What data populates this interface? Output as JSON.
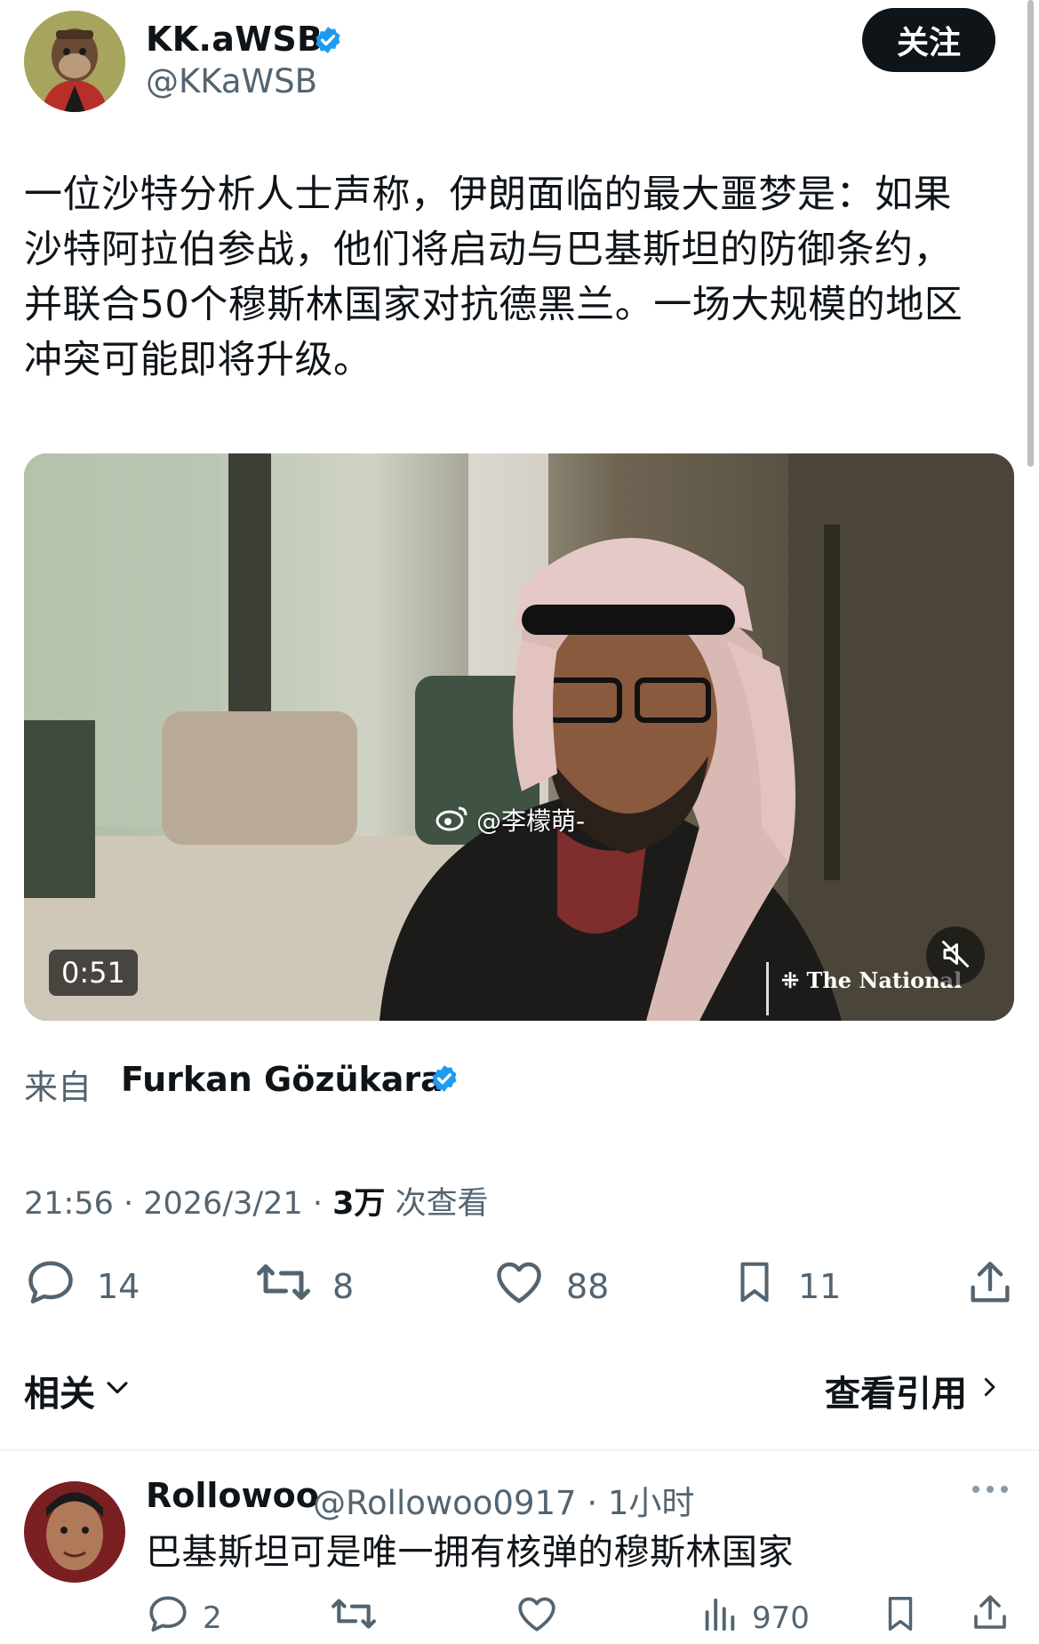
{
  "author": {
    "display_name": "KK.aWSB",
    "handle": "@KKaWSB",
    "verified": true
  },
  "follow_button": "关注",
  "tweet": {
    "text": "一位沙特分析人士声称，伊朗面临的最大噩梦是：如果\n沙特阿拉伯参战，他们将启动与巴基斯坦的防御条约，\n并联合50个穆斯林国家对抗德黑兰。一场大规模的地区\n冲突可能即将升级。"
  },
  "video": {
    "duration": "0:51",
    "brand": "The National",
    "watermark": "@李檬萌-"
  },
  "source": {
    "label": "来自",
    "name": "Furkan Gözükara"
  },
  "meta": {
    "time": "21:56 · 2026/3/21 · ",
    "views_count": "3万",
    "views_label": " 次查看"
  },
  "actions": {
    "replies": "14",
    "retweets": "8",
    "likes": "88",
    "bookmarks": "11"
  },
  "related": {
    "label": "相关",
    "view_quotes": "查看引用"
  },
  "reply": {
    "display_name": "Rollowoo",
    "handle_time": "@Rollowoo0917 · 1小时",
    "text": "巴基斯坦可是唯一拥有核弹的穆斯林国家",
    "replies": "2",
    "views": "970"
  },
  "colors": {
    "verified": "#1d9bf0",
    "text": "#0f1419",
    "secondary": "#536471"
  }
}
